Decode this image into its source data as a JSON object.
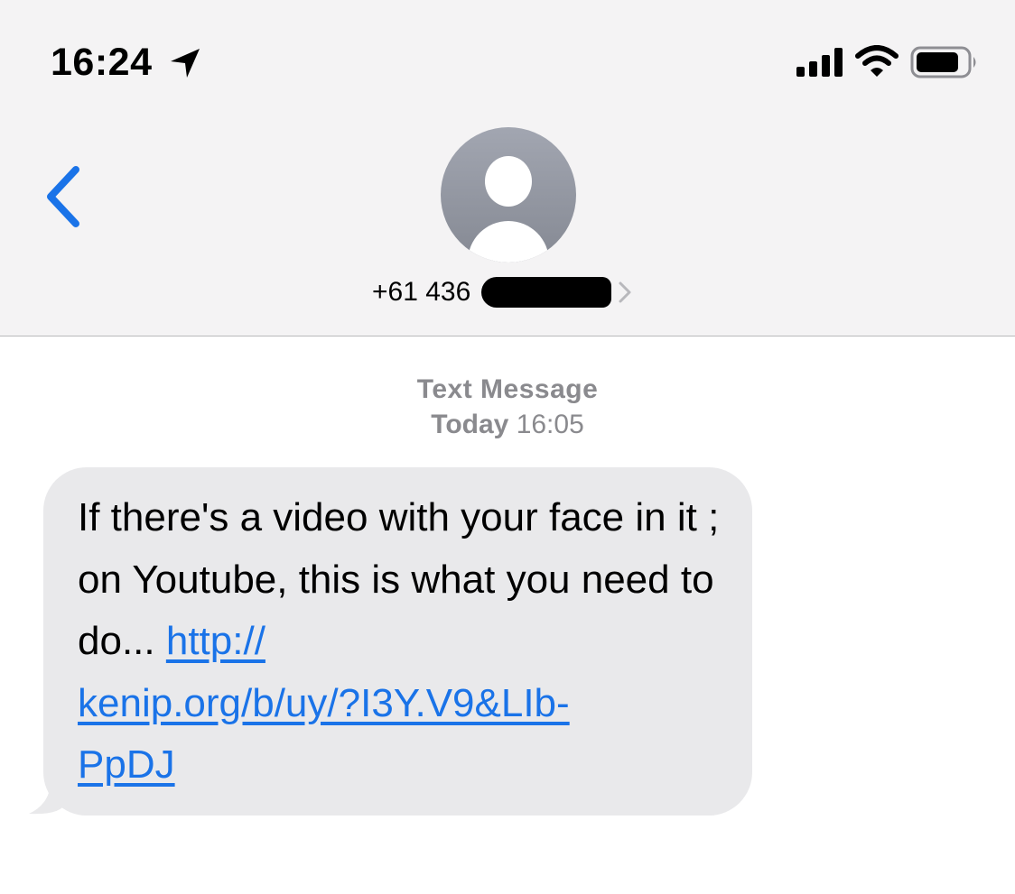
{
  "status_bar": {
    "time": "16:24",
    "icons": [
      "location-arrow-icon",
      "cellular-signal-icon",
      "wifi-icon",
      "battery-icon"
    ]
  },
  "nav": {
    "back_icon": "chevron-left-icon",
    "contact_number": "+61 436",
    "contact_chevron_icon": "chevron-right-icon"
  },
  "thread": {
    "label": "Text Message",
    "day": "Today",
    "time": "16:05"
  },
  "message": {
    "text": "If there's a video with your face in it ; on Youtube, this is what you need to do...",
    "link": "http://kenip.org/b/uy/?I3Y.V9&LIb-PpDJ",
    "link_line_1": "http://",
    "link_line_2": "kenip.org/b/uy/?I3Y.V9&LIb-",
    "link_line_3": "PpDJ"
  },
  "colors": {
    "accent": "#1a73e8",
    "header_bg": "#f4f3f4",
    "bubble_bg": "#e9e9eb",
    "meta_text": "#8a8a8e"
  }
}
